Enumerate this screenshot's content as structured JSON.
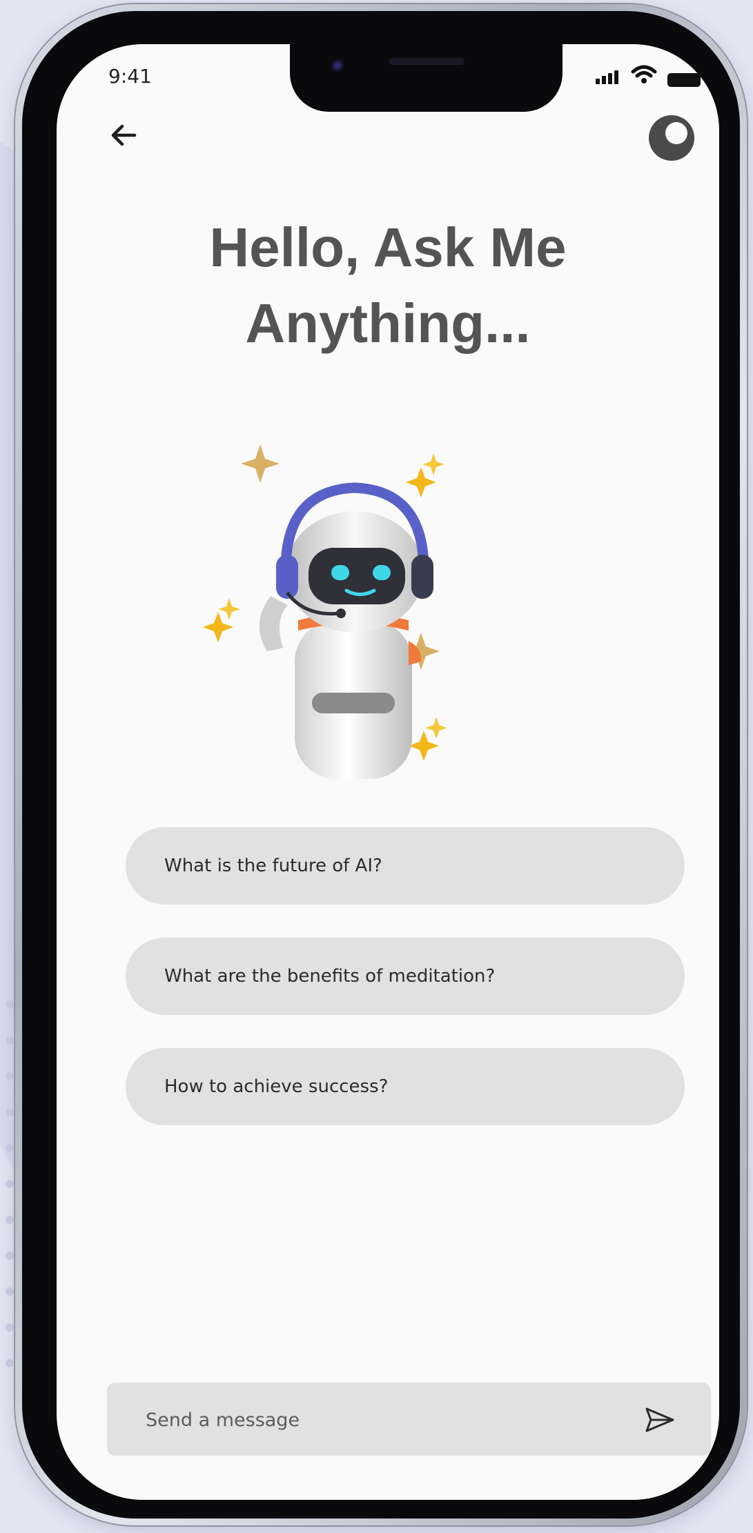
{
  "status_bar": {
    "time": "9:41"
  },
  "header": {
    "back_icon": "arrow-left-icon",
    "theme_icon": "theme-toggle-icon"
  },
  "title": "Hello, Ask Me\nAnything...",
  "illustration": {
    "icon": "robot-with-headset-icon",
    "accent_color": "#5961c8",
    "sparkle_color": "#f5b51f"
  },
  "suggestions": [
    "What is the future of AI?",
    "What are the benefits of meditation?",
    "How to achieve success?"
  ],
  "composer": {
    "placeholder": "Send a message",
    "send_icon": "send-icon"
  },
  "colors": {
    "background": "#e4e6f4",
    "screen": "#fafafa",
    "pill": "#e1e1e1",
    "title": "#545454"
  }
}
